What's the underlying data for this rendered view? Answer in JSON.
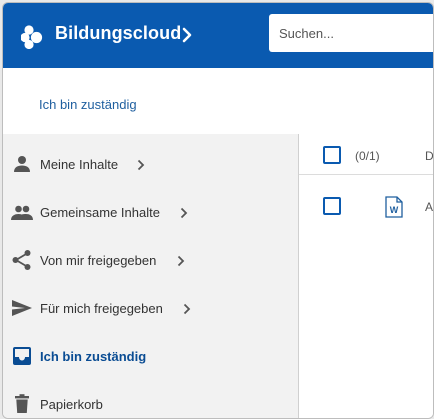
{
  "header": {
    "brand": "Bildungscloud",
    "search_placeholder": "Suchen..."
  },
  "breadcrumb": {
    "current": "Ich bin zuständig"
  },
  "sidebar": {
    "items": [
      {
        "label": "Meine Inhalte",
        "icon": "person-icon",
        "has_chevron": true,
        "active": false
      },
      {
        "label": "Gemeinsame Inhalte",
        "icon": "group-icon",
        "has_chevron": true,
        "active": false
      },
      {
        "label": "Von mir freigegeben",
        "icon": "share-icon",
        "has_chevron": true,
        "active": false
      },
      {
        "label": "Für mich freigegeben",
        "icon": "send-icon",
        "has_chevron": true,
        "active": false
      },
      {
        "label": "Ich bin zuständig",
        "icon": "inbox-icon",
        "has_chevron": false,
        "active": true
      },
      {
        "label": "Papierkorb",
        "icon": "trash-icon",
        "has_chevron": false,
        "active": false
      }
    ]
  },
  "file_list": {
    "selection_count": "(0/1)",
    "column_header_partial": "D",
    "rows": [
      {
        "icon": "word-document-icon",
        "name_partial": "A"
      }
    ]
  },
  "colors": {
    "brand_blue": "#0a5ab0",
    "active_text": "#0a4c93",
    "sidebar_bg": "#f2f2f2"
  }
}
